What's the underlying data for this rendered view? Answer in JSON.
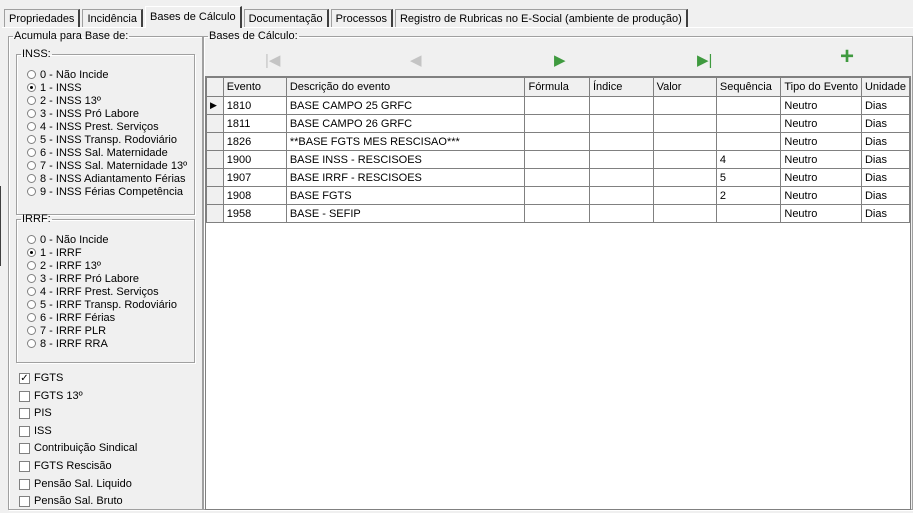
{
  "tabs": [
    "Propriedades",
    "Incidência",
    "Bases de Cálculo",
    "Documentação",
    "Processos",
    "Registro de Rubricas no E-Social (ambiente de produção)"
  ],
  "left_group_title": "Acumula para Base de:",
  "inss": {
    "title": "INSS:",
    "options": [
      "0 - Não Incide",
      "1 - INSS",
      "2 - INSS 13º",
      "3 - INSS Pró Labore",
      "4 - INSS Prest. Serviços",
      "5 - INSS Transp. Rodoviário",
      "6 - INSS Sal. Maternidade",
      "7 - INSS Sal. Maternidade 13º",
      "8 - INSS Adiantamento Férias",
      "9 - INSS Férias Competência"
    ],
    "selected": 1
  },
  "irrf": {
    "title": "IRRF:",
    "options": [
      "0 - Não Incide",
      "1 - IRRF",
      "2 - IRRF 13º",
      "3 - IRRF Pró Labore",
      "4 - IRRF Prest. Serviços",
      "5 - IRRF Transp. Rodoviário",
      "6 - IRRF Férias",
      "7 - IRRF PLR",
      "8 - IRRF RRA"
    ],
    "selected": 1
  },
  "checks": [
    {
      "label": "FGTS",
      "checked": true
    },
    {
      "label": "FGTS 13º",
      "checked": false
    },
    {
      "label": "PIS",
      "checked": false
    },
    {
      "label": "ISS",
      "checked": false
    },
    {
      "label": "Contribuição Sindical",
      "checked": false
    },
    {
      "label": "FGTS Rescisão",
      "checked": false
    },
    {
      "label": "Pensão Sal. Liquido",
      "checked": false
    },
    {
      "label": "Pensão Sal. Bruto",
      "checked": false
    }
  ],
  "bases_title": "Bases de Cálculo:",
  "toolbar": {
    "first": "|◀",
    "prev": "◀",
    "next": "▶",
    "last": "▶|",
    "add": "+"
  },
  "colors": {
    "accent_green": "#3f9a3f",
    "disabled_gray": "#c4c4c4"
  },
  "grid": {
    "columns": [
      "Evento",
      "Descrição do evento",
      "Fórmula",
      "Índice",
      "Valor",
      "Sequência",
      "Tipo do Evento",
      "Unidade"
    ],
    "rows": [
      {
        "evento": "1810",
        "descricao": "BASE CAMPO 25 GRFC",
        "formula": "",
        "indice": "",
        "valor": "",
        "sequencia": "",
        "tipo": "Neutro",
        "unidade": "Dias",
        "current": true
      },
      {
        "evento": "1811",
        "descricao": "BASE CAMPO 26 GRFC",
        "formula": "",
        "indice": "",
        "valor": "",
        "sequencia": "",
        "tipo": "Neutro",
        "unidade": "Dias"
      },
      {
        "evento": "1826",
        "descricao": "**BASE FGTS MES RESCISAO***",
        "formula": "",
        "indice": "",
        "valor": "",
        "sequencia": "",
        "tipo": "Neutro",
        "unidade": "Dias"
      },
      {
        "evento": "1900",
        "descricao": "BASE INSS - RESCISOES",
        "formula": "",
        "indice": "",
        "valor": "",
        "sequencia": "4",
        "tipo": "Neutro",
        "unidade": "Dias"
      },
      {
        "evento": "1907",
        "descricao": "BASE IRRF - RESCISOES",
        "formula": "",
        "indice": "",
        "valor": "",
        "sequencia": "5",
        "tipo": "Neutro",
        "unidade": "Dias"
      },
      {
        "evento": "1908",
        "descricao": "BASE FGTS",
        "formula": "",
        "indice": "",
        "valor": "",
        "sequencia": "2",
        "tipo": "Neutro",
        "unidade": "Dias"
      },
      {
        "evento": "1958",
        "descricao": "BASE - SEFIP",
        "formula": "",
        "indice": "",
        "valor": "",
        "sequencia": "",
        "tipo": "Neutro",
        "unidade": "Dias"
      }
    ]
  }
}
